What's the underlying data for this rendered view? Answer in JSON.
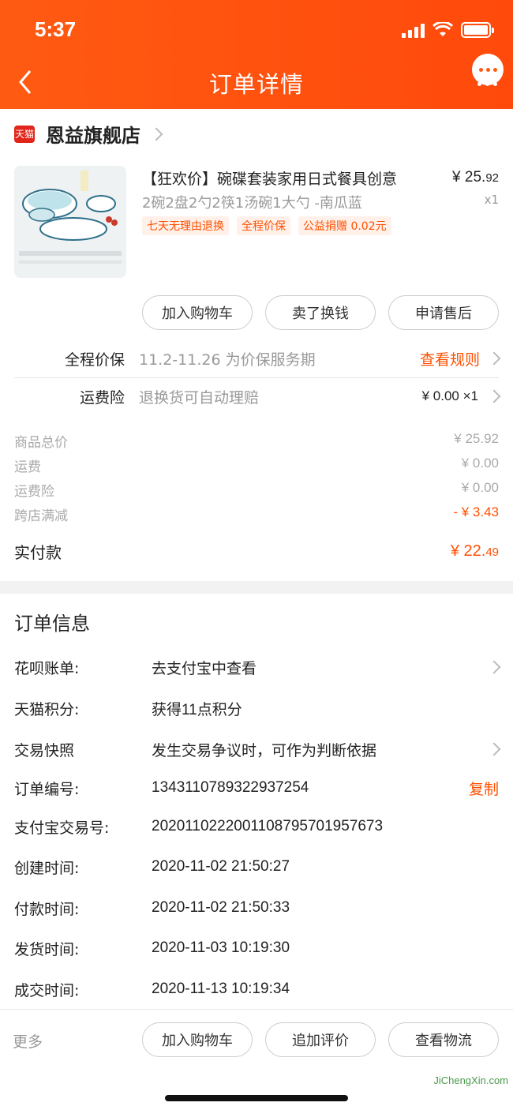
{
  "status": {
    "time": "5:37"
  },
  "header": {
    "title": "订单详情"
  },
  "shop": {
    "badge": "天猫",
    "name": "恩益旗舰店"
  },
  "product": {
    "title": "【狂欢价】碗碟套装家用日式餐具创意",
    "sku": "2碗2盘2勺2筷1汤碗1大勺 -南瓜蓝",
    "price_main": "¥ 25.",
    "price_cents": "92",
    "qty": "x1",
    "tags": [
      "七天无理由退换",
      "全程价保",
      "公益捐赠 0.02元"
    ]
  },
  "actions": [
    "加入购物车",
    "卖了换钱",
    "申请售后"
  ],
  "services": {
    "price_protect": {
      "label": "全程价保",
      "desc": "11.2-11.26 为价保服务期",
      "link": "查看规则"
    },
    "shipping_ins": {
      "label": "运费险",
      "desc": "退换货可自动理赔",
      "value": "¥ 0.00 ×1"
    }
  },
  "summary": {
    "rows": [
      {
        "label": "商品总价",
        "value": "¥ 25.92"
      },
      {
        "label": "运费",
        "value": "¥ 0.00"
      },
      {
        "label": "运费险",
        "value": "¥ 0.00"
      },
      {
        "label": "跨店满减",
        "value": "- ¥ 3.43"
      }
    ],
    "paid_label": "实付款",
    "paid_main": "¥ 22.",
    "paid_cents": "49"
  },
  "order_info": {
    "title": "订单信息",
    "rows": [
      {
        "label": "花呗账单:",
        "value": "去支付宝中查看"
      },
      {
        "label": "天猫积分:",
        "value": "获得11点积分"
      },
      {
        "label": "交易快照",
        "value": "发生交易争议时，可作为判断依据"
      },
      {
        "label": "订单编号:",
        "value": "1343110789322937254",
        "action": "复制"
      },
      {
        "label": "支付宝交易号:",
        "value": "2020110222001108795701957673"
      },
      {
        "label": "创建时间:",
        "value": "2020-11-02 21:50:27"
      },
      {
        "label": "付款时间:",
        "value": "2020-11-02 21:50:33"
      },
      {
        "label": "发货时间:",
        "value": "2020-11-03 10:19:30"
      },
      {
        "label": "成交时间:",
        "value": "2020-11-13 10:19:34"
      }
    ]
  },
  "bottom_bar": {
    "more": "更多",
    "buttons": [
      "加入购物车",
      "追加评价",
      "查看物流"
    ]
  },
  "watermark": "JiChengXin.com",
  "colors": {
    "brand": "#ff5000",
    "header": "#ff5a12"
  }
}
